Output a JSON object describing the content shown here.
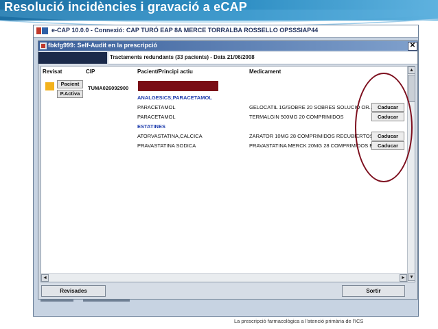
{
  "slide": {
    "title": "Resolució incidències i gravació a eCAP",
    "footer": "La prescripció farmacològica a l'atenció primària de l'ICS"
  },
  "app_window": {
    "title": "e-CAP 10.0.0 - Connexió: CAP TURÓ EAP 8A MERCE TORRALBA ROSSELLO OPSSSIAP44",
    "logo_icon": "ecap-logo-icon"
  },
  "dialog": {
    "title": "fbkfg999: Self-Audit en la prescripció",
    "close_label": "✕",
    "banner": "Tractaments redundants (33 pacients) - Data 21/06/2008",
    "columns": {
      "revisat": "Revisat",
      "cip": "CIP",
      "patient": "Pacient/Principi actiu",
      "medication": "Medicament"
    },
    "patient": {
      "pacient_button": "Pacient",
      "pactiva_button": "P.Activa",
      "cip": "TUMA026092900",
      "flag_color": "#f3b21c"
    },
    "groups": [
      {
        "label": "ANALGESICS;PARACETAMOL",
        "rows": [
          {
            "active": "PARACETAMOL",
            "medication": "GELOCATIL 1G/SOBRE 20 SOBRES SOLUCIO OR...",
            "action": "Caducar"
          },
          {
            "active": "PARACETAMOL",
            "medication": "TERMALGIN 500MG 20 COMPRIMIDOS",
            "action": "Caducar"
          }
        ]
      },
      {
        "label": "ESTATINES",
        "rows": [
          {
            "active": "ATORVASTATINA,CALCICA",
            "medication": "ZARATOR 10MG 28 COMPRIMIDOS RECUBIERTOS",
            "action": "Caducar"
          },
          {
            "active": "PRAVASTATINA SODICA",
            "medication": "PRAVASTATINA MERCK 20MG 28 COMPRIMIDOS E",
            "action": "Caducar"
          }
        ]
      }
    ],
    "buttons": {
      "revisades": "Revisades",
      "sortir": "Sortir"
    },
    "scroll": {
      "up": "▲",
      "down": "▼",
      "left": "◄",
      "right": "►"
    }
  },
  "colors": {
    "header_blue": "#1d6fa3",
    "annotation_red": "#7d0f1e",
    "group_blue": "#203fae"
  }
}
